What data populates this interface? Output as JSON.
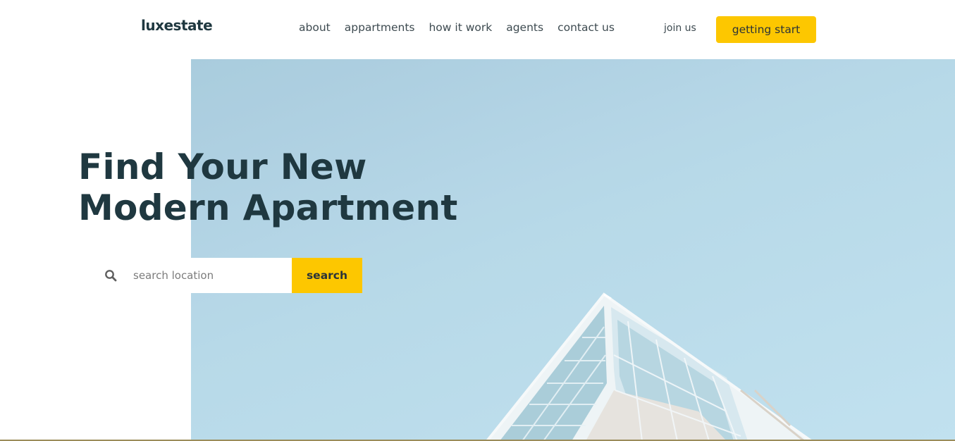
{
  "header": {
    "logo": "luxestate",
    "nav": [
      {
        "label": "about"
      },
      {
        "label": "appartments"
      },
      {
        "label": "how it work"
      },
      {
        "label": "agents"
      },
      {
        "label": "contact us"
      }
    ],
    "join_label": "join us",
    "cta_label": "getting start"
  },
  "hero": {
    "title_line1": "Find Your New",
    "title_line2": "Modern Apartment",
    "search": {
      "placeholder": "search location",
      "icon": "search-icon",
      "button_label": "search"
    },
    "image": "modern-building-photo"
  },
  "colors": {
    "accent": "#fdc700",
    "heading": "#1f3840",
    "sky": "#b5d8e8"
  }
}
